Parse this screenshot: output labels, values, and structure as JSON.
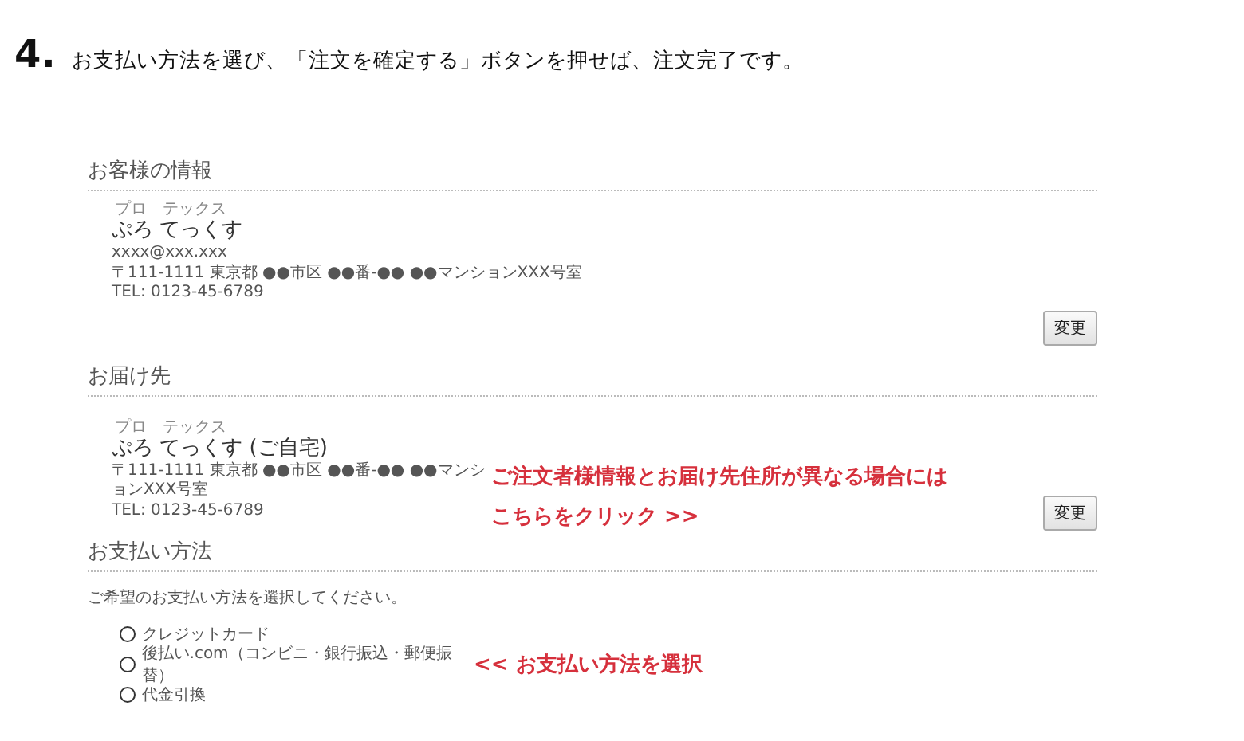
{
  "step": {
    "number": "4.",
    "text": "お支払い方法を選び、「注文を確定する」ボタンを押せば、注文完了です。"
  },
  "sections": [
    {
      "kind": "customer",
      "heading": "お客様の情報",
      "ruby": "プロ　テックス",
      "name": "ぷろ てっくす",
      "lines": [
        "xxxx@xxx.xxx",
        "〒111-1111 東京都 ●●市区 ●●番-●● ●●マンションXXX号室",
        "TEL: 0123-45-6789"
      ],
      "button": "変更"
    },
    {
      "kind": "delivery",
      "heading": "お届け先",
      "ruby": "プロ　テックス",
      "name": "ぷろ てっくす (ご自宅)",
      "lines": [
        "〒111-1111 東京都 ●●市区 ●●番-●● ●●マンションXXX号室",
        "TEL: 0123-45-6789"
      ],
      "note": [
        "ご注文者様情報とお届け先住所が異なる場合には",
        "こちらをクリック >>"
      ],
      "button": "変更"
    }
  ],
  "payment": {
    "heading": "お支払い方法",
    "instruction": "ご希望のお支払い方法を選択してください。",
    "options": [
      {
        "label": "クレジットカード",
        "selected": false
      },
      {
        "label": "後払い.com（コンビニ・銀行振込・郵便振替）",
        "selected": false
      },
      {
        "label": "代金引換",
        "selected": false
      }
    ],
    "note": "<< お支払い方法を選択"
  }
}
